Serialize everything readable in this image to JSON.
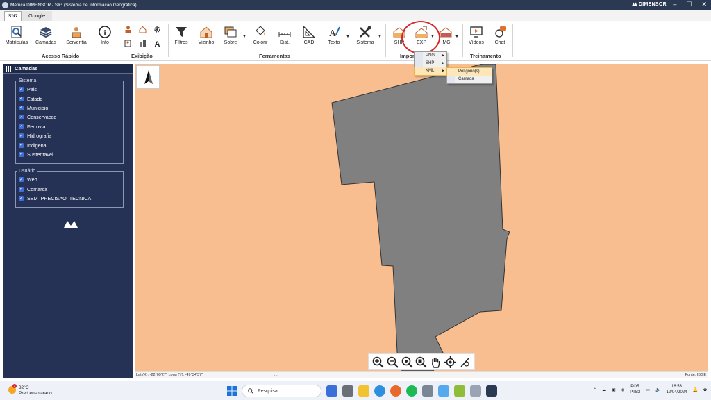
{
  "window": {
    "title": "Métrica DIMENSOR - SIG (Sistema de Informação Geográfica)",
    "brand": "DIMENSOR",
    "controls": [
      "–",
      "☐",
      "✕"
    ]
  },
  "tabs": [
    "SIG",
    "Google"
  ],
  "ribbon": {
    "groups": {
      "acesso_rapido": "Acesso Rápido",
      "exibicao": "Exibição",
      "ferramentas": "Ferramentas",
      "importar_exportar": "Importar/Exportar",
      "treinamento": "Treinamento"
    },
    "buttons": {
      "matriculas": "Matrículas",
      "camadas": "Camadas",
      "serventia": "Serventia",
      "info": "Info",
      "filtros": "Filtros",
      "vizinho": "Vizinho",
      "sobre": "Sobre",
      "colorir": "Colorir",
      "dist": "Dist.",
      "cad": "CAD",
      "texto": "Texto",
      "sistema": "Sistema",
      "shp": "SHP",
      "exp": "EXP",
      "img": "IMG",
      "videos": "Vídeos",
      "chat": "Chat"
    }
  },
  "export_menu": {
    "items": [
      "PNG",
      "SHP",
      "KML"
    ],
    "kml_submenu": [
      "Polígono(s)",
      "Camada"
    ],
    "highlighted": "KML"
  },
  "sidebar": {
    "title": "Camadas",
    "sistema_label": "Sistema",
    "sistema_layers": [
      "Pais",
      "Estado",
      "Municipio",
      "Conservacao",
      "Ferrovia",
      "Hidrografia",
      "Indigena",
      "Sustentavel"
    ],
    "usuario_label": "Usuário",
    "usuario_layers": [
      "Web",
      "Comarca",
      "SEM_PRECISAO_TECNICA"
    ]
  },
  "status": {
    "coords": "Lat (X): -22°09'27\"  Long (Y): -49°34'37\"",
    "extra": "...",
    "fonte": "Fonte: IBGE"
  },
  "taskbar": {
    "weather_temp": "32°C",
    "weather_desc": "Pred ensolarado",
    "weather_badge": "1",
    "search_placeholder": "Pesquisar",
    "lang_1": "POR",
    "lang_2": "PTB2",
    "time": "16:53",
    "date": "12/04/2024"
  },
  "colors": {
    "map_background": "#f9be8f",
    "polygon_fill": "#808080",
    "sidebar_background": "#253155",
    "highlight_circle": "#d42828"
  }
}
